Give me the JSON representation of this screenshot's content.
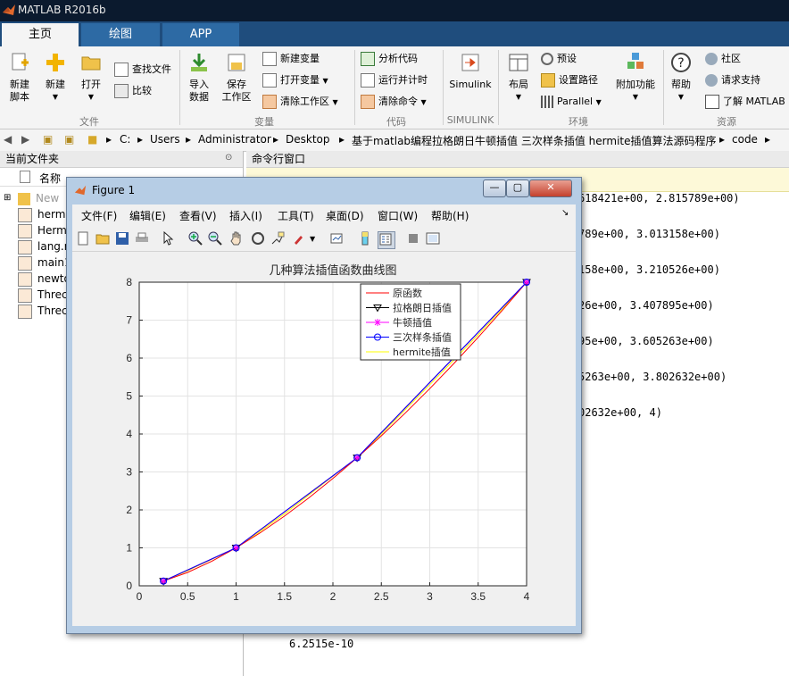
{
  "window": {
    "title": "MATLAB R2016b"
  },
  "tabs": [
    {
      "label": "主页"
    },
    {
      "label": "绘图"
    },
    {
      "label": "APP"
    }
  ],
  "ribbon": {
    "new_script": "新建\n脚本",
    "new": "新建",
    "open": "打开",
    "find_files": "查找文件",
    "compare": "比较",
    "import_data": "导入\n数据",
    "save_workspace": "保存\n工作区",
    "new_variable": "新建变量",
    "open_variable": "打开变量",
    "clear_workspace": "清除工作区",
    "analyze_code": "分析代码",
    "run_time": "运行并计时",
    "clear_commands": "清除命令",
    "simulink": "Simulink",
    "layout": "布局",
    "preferences": "预设",
    "set_path": "设置路径",
    "parallel": "Parallel",
    "addons": "附加功能",
    "help": "帮助",
    "community": "社区",
    "support": "请求支持",
    "learn": "了解 MATLAB",
    "groups": {
      "file": "文件",
      "variable": "变量",
      "code": "代码",
      "simulink": "SIMULINK",
      "environment": "环境",
      "resources": "资源"
    }
  },
  "address": {
    "path": [
      "C:",
      "Users",
      "Administrator",
      "Desktop",
      "基于matlab编程拉格朗日牛顿插值 三次样条插值 hermite插值算法源码程序",
      "code"
    ]
  },
  "current_folder": {
    "title": "当前文件夹",
    "column": "名称",
    "items": [
      "New",
      "hermi",
      "Herm",
      "lang.r",
      "main1",
      "newto",
      "Threc",
      "Threc"
    ]
  },
  "command_window": {
    "title": "命令行窗口",
    "lines": [
      "618421e+00, 2.815789e+00)",
      "789e+00, 3.013158e+00)",
      "158e+00, 3.210526e+00)",
      "26e+00, 3.407895e+00)",
      "95e+00, 3.605263e+00)",
      "5263e+00, 3.802632e+00)",
      "02632e+00, 4)"
    ],
    "bottom_value": "6.2515e-10"
  },
  "figure": {
    "title": "Figure 1",
    "menu": [
      "文件(F)",
      "编辑(E)",
      "查看(V)",
      "插入(I)",
      "工具(T)",
      "桌面(D)",
      "窗口(W)",
      "帮助(H)"
    ]
  },
  "colors": {
    "original": "#ff0000",
    "lagrange": "#000000",
    "newton": "#ff00ff",
    "spline": "#0000ff",
    "hermite": "#ffff00"
  },
  "chart_data": {
    "type": "line",
    "title": "几种算法插值函数曲线图",
    "xlim": [
      0,
      4
    ],
    "ylim": [
      0,
      8
    ],
    "xticks": [
      0,
      0.5,
      1,
      1.5,
      2,
      2.5,
      3,
      3.5,
      4
    ],
    "xtick_labels": [
      "0",
      "0.5",
      "1",
      "1.5",
      "2",
      "2.5",
      "3",
      "3.5",
      "4"
    ],
    "yticks": [
      0,
      1,
      2,
      3,
      4,
      5,
      6,
      7,
      8
    ],
    "ytick_labels": [
      "0",
      "1",
      "2",
      "3",
      "4",
      "5",
      "6",
      "7",
      "8"
    ],
    "grid": true,
    "legend_position": "top-right",
    "nodes": {
      "x": [
        0.25,
        1,
        2.25,
        4
      ],
      "y": [
        0.125,
        1,
        3.375,
        8
      ]
    },
    "series": [
      {
        "name": "原函数",
        "marker": "none",
        "x": [
          0.25,
          0.5,
          0.75,
          1,
          1.25,
          1.5,
          1.75,
          2,
          2.25,
          2.5,
          2.75,
          3,
          3.25,
          3.5,
          3.75,
          4
        ],
        "y": [
          0.125,
          0.354,
          0.65,
          1.0,
          1.398,
          1.837,
          2.315,
          2.828,
          3.375,
          3.953,
          4.56,
          5.196,
          5.859,
          6.548,
          7.262,
          8.0
        ]
      },
      {
        "name": "拉格朗日插值",
        "marker": "triangle-down",
        "x": [
          0.25,
          1,
          2.25,
          4
        ],
        "y": [
          0.125,
          1,
          3.375,
          8
        ]
      },
      {
        "name": "牛顿插值",
        "marker": "asterisk",
        "x": [
          0.25,
          1,
          2.25,
          4
        ],
        "y": [
          0.125,
          1,
          3.375,
          8
        ]
      },
      {
        "name": "三次样条插值",
        "marker": "circle",
        "x": [
          0.25,
          1,
          2.25,
          4
        ],
        "y": [
          0.125,
          1,
          3.375,
          8
        ]
      },
      {
        "name": "hermite插值",
        "marker": "none",
        "x": [
          0.25,
          0.5,
          0.75,
          1,
          1.25,
          1.5,
          1.75,
          2,
          2.25,
          2.5,
          2.75,
          3,
          3.25,
          3.5,
          3.75,
          4
        ],
        "y": [
          0.125,
          0.4,
          0.7,
          1.0,
          1.44,
          1.9,
          2.39,
          2.89,
          3.375,
          4.0,
          4.65,
          5.3,
          5.95,
          6.62,
          7.3,
          8.0
        ]
      }
    ]
  }
}
